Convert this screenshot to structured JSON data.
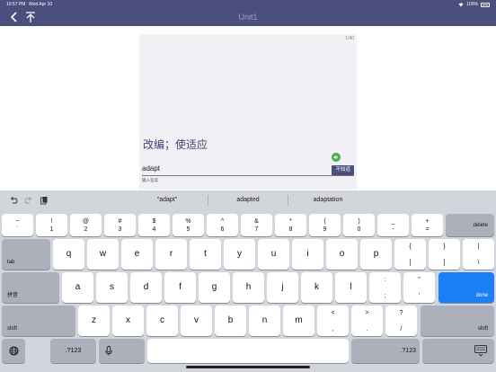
{
  "status": {
    "time": "10:57 PM",
    "date": "Wed Apr 10",
    "battery": "100%"
  },
  "nav": {
    "title": "Unit1"
  },
  "card": {
    "counter": "1/40",
    "meaning": "改编；使适应",
    "answer_value": "adapt",
    "dont_know_label": "不知道",
    "hint": "输入答案"
  },
  "keyboard": {
    "suggestions": [
      "\"adapt\"",
      "adapted",
      "adaptation"
    ],
    "number_row": [
      {
        "top": "~",
        "bot": "`"
      },
      {
        "top": "!",
        "bot": "1"
      },
      {
        "top": "@",
        "bot": "2"
      },
      {
        "top": "#",
        "bot": "3"
      },
      {
        "top": "$",
        "bot": "4"
      },
      {
        "top": "%",
        "bot": "5"
      },
      {
        "top": "^",
        "bot": "6"
      },
      {
        "top": "&",
        "bot": "7"
      },
      {
        "top": "*",
        "bot": "8"
      },
      {
        "top": "(",
        "bot": "9"
      },
      {
        "top": ")",
        "bot": "0"
      },
      {
        "top": "_",
        "bot": "-"
      },
      {
        "top": "+",
        "bot": "="
      }
    ],
    "delete_label": "delete",
    "tab_label": "tab",
    "row_q": [
      "q",
      "w",
      "e",
      "r",
      "t",
      "y",
      "u",
      "i",
      "o",
      "p"
    ],
    "row_q_sym": [
      {
        "top": "{",
        "bot": "["
      },
      {
        "top": "}",
        "bot": "]"
      },
      {
        "top": "|",
        "bot": "\\"
      }
    ],
    "pinyin_label": "拼音",
    "row_a": [
      "a",
      "s",
      "d",
      "f",
      "g",
      "h",
      "j",
      "k",
      "l"
    ],
    "row_a_sym": [
      {
        "top": ":",
        "bot": ";"
      },
      {
        "top": "\"",
        "bot": "'"
      }
    ],
    "done_label": "done",
    "shift_label": "shift",
    "row_z": [
      "z",
      "x",
      "c",
      "v",
      "b",
      "n",
      "m"
    ],
    "row_z_sym": [
      {
        "top": "<",
        "bot": ","
      },
      {
        "top": ">",
        "bot": "."
      },
      {
        "top": "?",
        "bot": "/"
      }
    ],
    "numbers_label": ".?123",
    "colors": {
      "accent": "#1a7ef5",
      "nav": "#4b4f7d"
    }
  }
}
